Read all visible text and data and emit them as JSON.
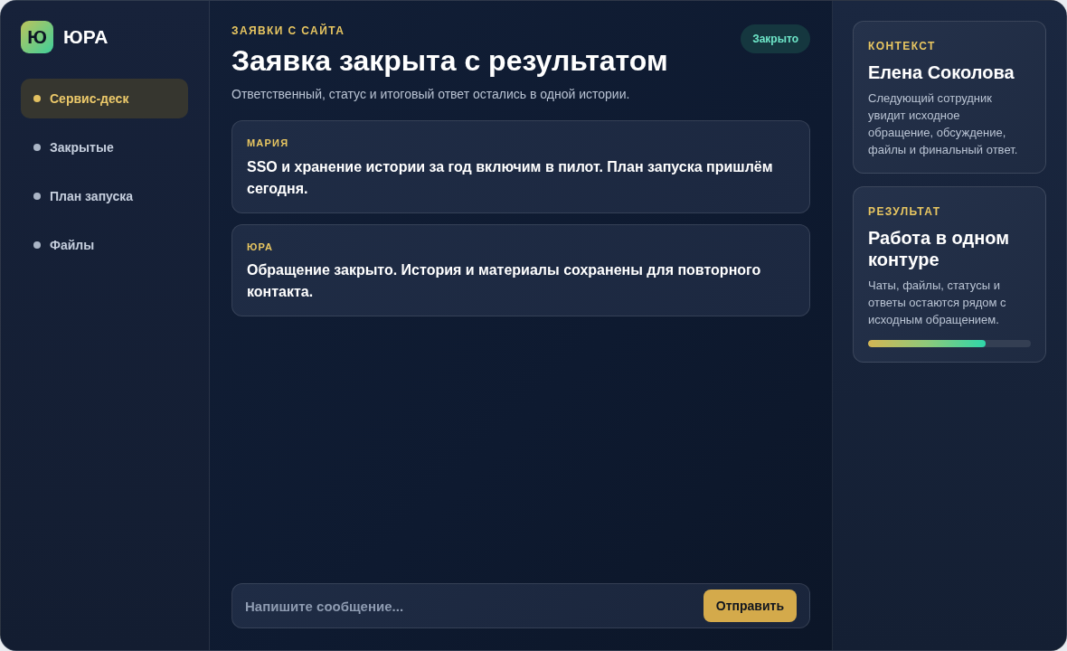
{
  "brand": {
    "logo_letter": "Ю",
    "name": "ЮРА"
  },
  "nav": [
    {
      "label": "Сервис-деск",
      "selected": true
    },
    {
      "label": "Закрытые",
      "selected": false
    },
    {
      "label": "План запуска",
      "selected": false
    },
    {
      "label": "Файлы",
      "selected": false
    }
  ],
  "header": {
    "kicker": "ЗАЯВКИ С САЙТА",
    "title": "Заявка закрыта с результатом",
    "subtitle": "Ответственный, статус и итоговый ответ остались в одной истории.",
    "status": "Закрыто"
  },
  "messages": [
    {
      "author": "МАРИЯ",
      "text": "SSO и хранение истории за год включим в пилот. План запуска пришлём сегодня."
    },
    {
      "author": "ЮРА",
      "text": "Обращение закрыто. История и материалы сохранены для повторного контакта."
    }
  ],
  "composer": {
    "placeholder": "Напишите сообщение...",
    "send_label": "Отправить"
  },
  "side_cards": [
    {
      "kind": "text",
      "kicker": "КОНТЕКСТ",
      "title": "Елена Соколова",
      "text": "Следующий сотрудник увидит исходное обращение, обсуждение, файлы и финальный ответ."
    },
    {
      "kind": "progress",
      "kicker": "РЕЗУЛЬТАТ",
      "title": "Работа в одном контуре",
      "text": "Чаты, файлы, статусы и ответы остаются рядом с исходным обращением.",
      "level": 0.72
    }
  ]
}
